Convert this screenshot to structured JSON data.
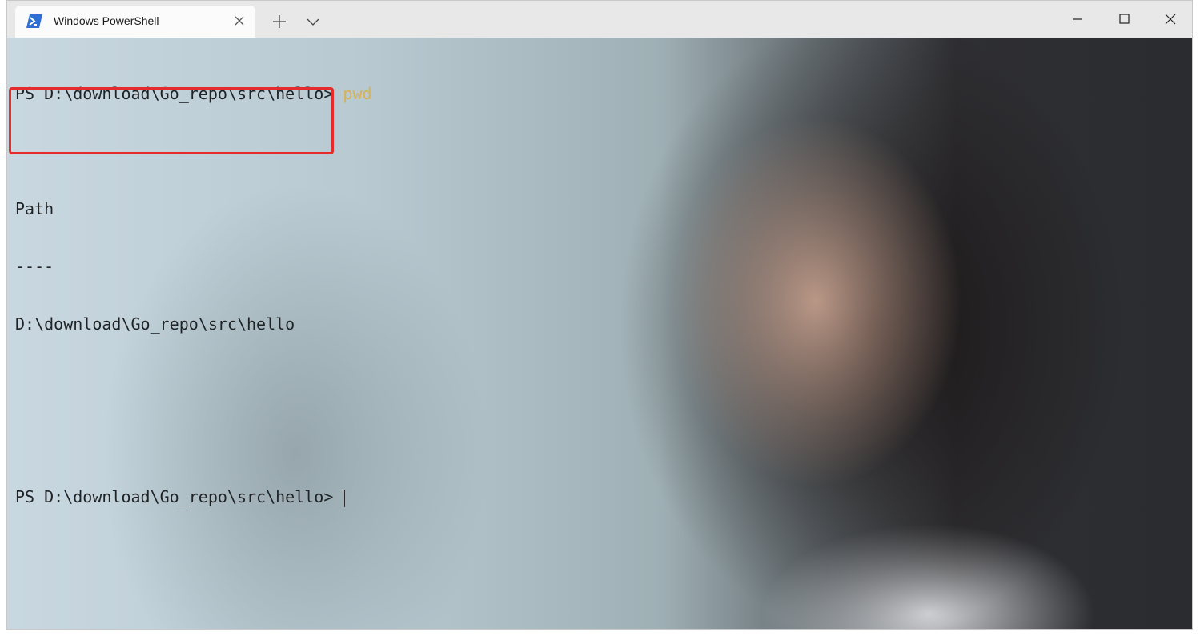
{
  "window": {
    "tab_title": "Windows PowerShell",
    "tab_icon": "powershell-icon",
    "new_tab_icon": "plus-icon",
    "dropdown_icon": "chevron-down-icon",
    "minimize_icon": "minimize-icon",
    "maximize_icon": "maximize-icon",
    "close_icon": "close-icon"
  },
  "terminal": {
    "prompt1": "PS D:\\download\\Go_repo\\src\\hello> ",
    "command1": "pwd",
    "output_header": "Path",
    "output_separator": "----",
    "output_value": "D:\\download\\Go_repo\\src\\hello",
    "prompt2": "PS D:\\download\\Go_repo\\src\\hello> "
  },
  "colors": {
    "command": "#d9b24f",
    "highlight_box": "#e52b2b",
    "text": "#1f2326",
    "tab_icon": "#2f6fd1"
  }
}
